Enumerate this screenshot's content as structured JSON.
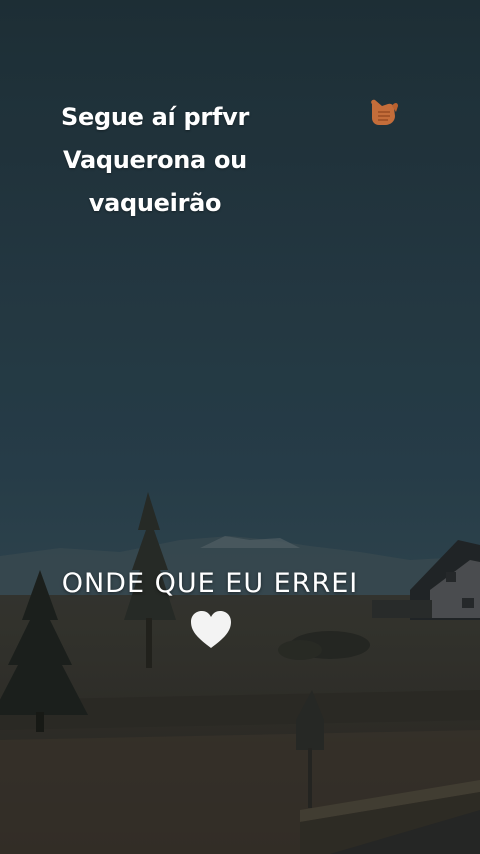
{
  "caption_top": {
    "line1": "Segue aí prfvr",
    "line2": "Vaquerona ou",
    "line3": "vaqueirão"
  },
  "emoji_top": "call-me-hand-icon",
  "caption_mid": {
    "text": "ONDE QUE EU ERREI"
  },
  "emoji_mid": "white-heart-icon",
  "colors": {
    "sky_top": "#23383f",
    "sky_bottom": "#2f4a58",
    "ground": "#3d382f",
    "caption": "#ffffff",
    "hand": "#c9743f",
    "heart": "#f4f4f4"
  }
}
